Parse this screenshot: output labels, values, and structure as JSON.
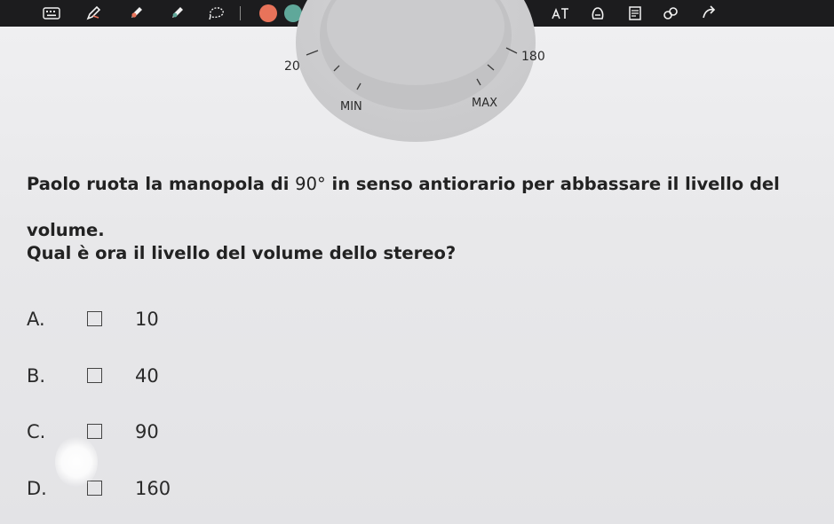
{
  "toolbar": {
    "tools": [
      {
        "name": "keyboard-icon",
        "symbol": ""
      },
      {
        "name": "pen-icon",
        "symbol": ""
      },
      {
        "name": "marker-icon",
        "symbol": ""
      },
      {
        "name": "highlighter-icon",
        "symbol": ""
      },
      {
        "name": "lasso-icon",
        "symbol": ""
      }
    ],
    "colors": [
      {
        "name": "color-orange",
        "hex": "#e8735a"
      },
      {
        "name": "color-teal",
        "hex": "#5fa89a"
      },
      {
        "name": "color-dark-red",
        "hex": "#8e1a1f"
      }
    ],
    "actions": [
      {
        "name": "line-thickness-icon"
      },
      {
        "name": "undo-icon"
      },
      {
        "name": "redo-icon"
      },
      {
        "name": "text-tool-icon"
      },
      {
        "name": "align-icon"
      },
      {
        "name": "text-size-icon"
      },
      {
        "name": "stamp-icon"
      },
      {
        "name": "page-icon"
      },
      {
        "name": "link-icon"
      },
      {
        "name": "share-icon"
      }
    ]
  },
  "dial": {
    "labels": {
      "left_value": "20",
      "right_value": "180",
      "min": "MIN",
      "max": "MAX"
    }
  },
  "question": {
    "text_before": "Paolo ruota la manopola di ",
    "angle": "90°",
    "text_after": " in senso antiorario per abbassare il livello del volume.",
    "prompt": "Qual è ora il livello del volume dello stereo?"
  },
  "options": [
    {
      "letter": "A.",
      "value": "10"
    },
    {
      "letter": "B.",
      "value": "40"
    },
    {
      "letter": "C.",
      "value": "90"
    },
    {
      "letter": "D.",
      "value": "160"
    }
  ]
}
